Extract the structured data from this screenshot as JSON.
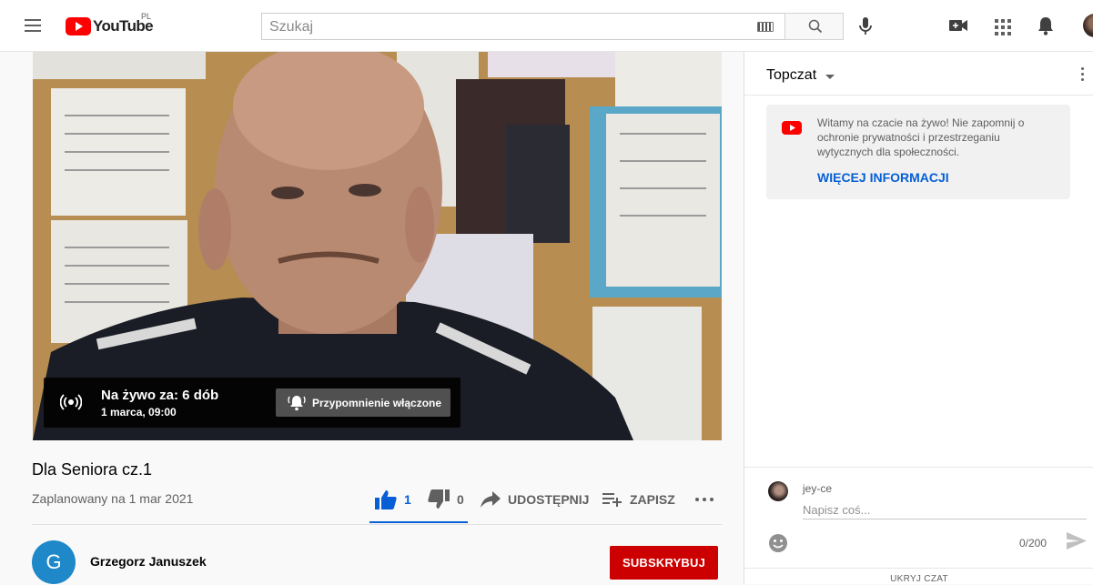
{
  "header": {
    "logo_text": "YouTube",
    "country_code": "PL",
    "search_placeholder": "Szukaj"
  },
  "player": {
    "live_title": "Na żywo za: 6 dób",
    "live_date": "1 marca, 09:00",
    "reminder_label": "Przypomnienie włączone"
  },
  "video": {
    "title": "Dla Seniora cz.1",
    "scheduled": "Zaplanowany na 1 mar 2021",
    "likes": "1",
    "dislikes": "0",
    "share_label": "UDOSTĘPNIJ",
    "save_label": "ZAPISZ"
  },
  "channel": {
    "avatar_letter": "G",
    "name": "Grzegorz Januszek",
    "subscribe_label": "SUBSKRYBUJ"
  },
  "chat": {
    "mode_label": "Topczat",
    "notice_text": "Witamy na czacie na żywo! Nie zapomnij o ochronie prywatności i przestrzeganiu wytycznych dla społeczności.",
    "notice_link": "WIĘCEJ INFORMACJI",
    "username": "jey-ce",
    "input_placeholder": "Napisz coś...",
    "char_count": "0/200",
    "hide_label": "UKRYJ CZAT"
  },
  "colors": {
    "brand_red": "#ff0000",
    "subscribe_red": "#cc0000",
    "link_blue": "#065fd4",
    "channel_avatar": "#1e88c9"
  }
}
